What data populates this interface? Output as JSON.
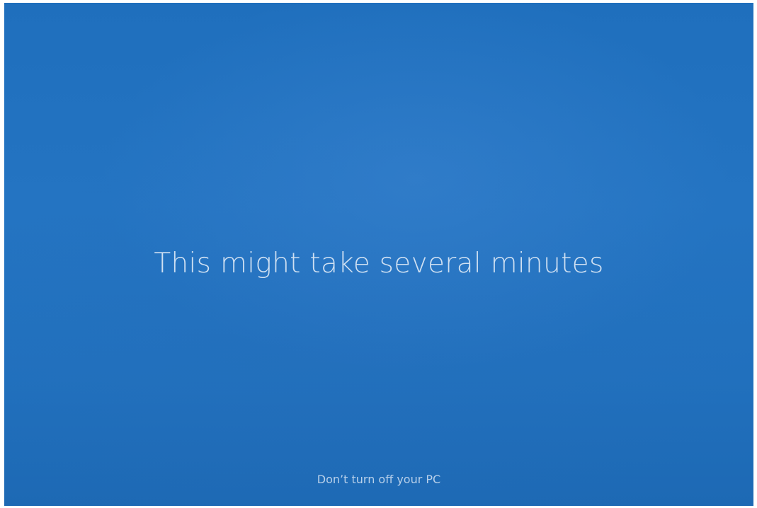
{
  "screen": {
    "background_color": "#2372c0",
    "text_color": "#cfe0f2",
    "main_message": "This might take several minutes",
    "footer_message": "Don’t turn off your PC"
  }
}
